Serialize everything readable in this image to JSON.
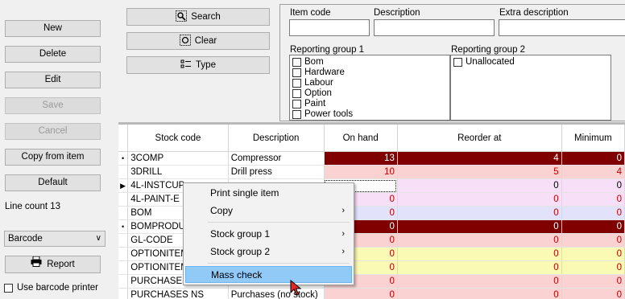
{
  "left_panel": {
    "buttons": [
      {
        "label": "New",
        "enabled": true
      },
      {
        "label": "Delete",
        "enabled": true
      },
      {
        "label": "Edit",
        "enabled": true
      },
      {
        "label": "Save",
        "enabled": false
      },
      {
        "label": "Cancel",
        "enabled": false
      },
      {
        "label": "Copy from item",
        "enabled": true
      },
      {
        "label": "Default",
        "enabled": true
      }
    ],
    "line_count": "Line count 13",
    "barcode_select": "Barcode",
    "report_label": "Report",
    "use_barcode_printer": "Use barcode printer"
  },
  "search": {
    "search_label": "Search",
    "clear_label": "Clear",
    "type_label": "Type"
  },
  "filter": {
    "item_code_label": "Item code",
    "description_label": "Description",
    "extra_description_label": "Extra description",
    "reporting_group_1_label": "Reporting group 1",
    "reporting_group_2_label": "Reporting group 2",
    "reporting_group_1_items": [
      "Bom",
      "Hardware",
      "Labour",
      "Option",
      "Paint",
      "Power tools"
    ],
    "reporting_group_2_items": [
      "Unallocated"
    ]
  },
  "grid": {
    "columns": [
      "Stock code",
      "Description",
      "On hand",
      "Reorder at",
      "Minimum"
    ],
    "rows": [
      {
        "marker": "•",
        "code": "3COMP",
        "desc": "Compressor",
        "on_hand": "13",
        "reorder": "4",
        "minimum": "0",
        "color": "#800000",
        "fg": "#ffffff"
      },
      {
        "marker": "",
        "code": "3DRILL",
        "desc": "Drill press",
        "on_hand": "10",
        "reorder": "5",
        "minimum": "4",
        "color": "#fad2d2",
        "fg": "#c00000"
      },
      {
        "marker": "▶",
        "code": "4L-INSTCUP",
        "desc": "",
        "on_hand": "",
        "reorder": "0",
        "minimum": "0",
        "color": "#f7dff7",
        "fg": "#000000"
      },
      {
        "marker": "",
        "code": "4L-PAINT-E",
        "desc": "",
        "on_hand": "0",
        "reorder": "0",
        "minimum": "0",
        "color": "#f7dff7",
        "fg": "#c00000"
      },
      {
        "marker": "",
        "code": "BOM",
        "desc": "",
        "on_hand": "0",
        "reorder": "0",
        "minimum": "0",
        "color": "#e2e2fa",
        "fg": "#c00000"
      },
      {
        "marker": "•",
        "code": "BOMPRODU",
        "desc": "",
        "on_hand": "0",
        "reorder": "0",
        "minimum": "0",
        "color": "#800000",
        "fg": "#ffffff"
      },
      {
        "marker": "",
        "code": "GL-CODE",
        "desc": "",
        "on_hand": "0",
        "reorder": "0",
        "minimum": "0",
        "color": "#fad2d2",
        "fg": "#c00000"
      },
      {
        "marker": "",
        "code": "OPTIONITEM",
        "desc": "",
        "on_hand": "0",
        "reorder": "0",
        "minimum": "0",
        "color": "#fafab4",
        "fg": "#c00000"
      },
      {
        "marker": "",
        "code": "OPTIONITEM",
        "desc": "",
        "on_hand": "0",
        "reorder": "0",
        "minimum": "0",
        "color": "#fafab4",
        "fg": "#c00000"
      },
      {
        "marker": "",
        "code": "PURCHASES",
        "desc": "",
        "on_hand": "0",
        "reorder": "0",
        "minimum": "0",
        "color": "#fad2d2",
        "fg": "#c00000"
      },
      {
        "marker": "",
        "code": "PURCHASES NS",
        "desc": "Purchases (no stock)",
        "on_hand": "0",
        "reorder": "0",
        "minimum": "0",
        "color": "#fad2d2",
        "fg": "#c00000"
      }
    ]
  },
  "context_menu": {
    "items": [
      {
        "label": "Print single item",
        "submenu": false
      },
      {
        "label": "Copy",
        "submenu": true
      },
      {
        "label": "Stock group 1",
        "submenu": true
      },
      {
        "label": "Stock group 2",
        "submenu": true
      },
      {
        "label": "Mass check",
        "submenu": false
      }
    ],
    "highlighted": "Mass check"
  },
  "colors": {
    "dark_red": "#800000",
    "pink": "#fad2d2",
    "violet": "#f7dff7",
    "lavender": "#e2e2fa",
    "yellow": "#fafab4",
    "menu_highlight": "#91c9f7"
  }
}
